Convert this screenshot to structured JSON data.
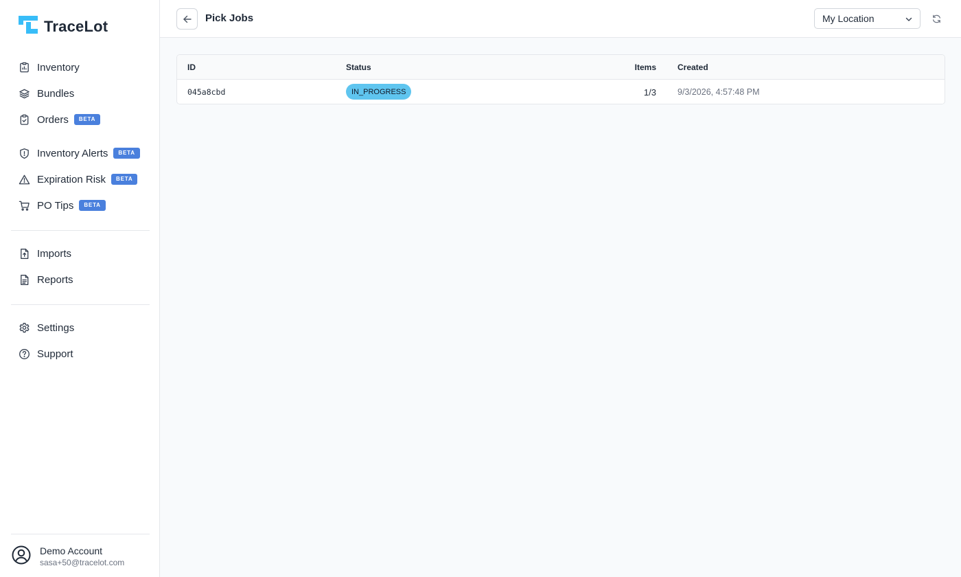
{
  "app": {
    "name": "TraceLot"
  },
  "sidebar": {
    "items": [
      {
        "label": "Inventory",
        "icon": "inventory-icon"
      },
      {
        "label": "Bundles",
        "icon": "layers-icon"
      },
      {
        "label": "Orders",
        "icon": "clipboard-icon",
        "badge": "BETA"
      },
      {
        "label": "Inventory Alerts",
        "icon": "shield-icon",
        "badge": "BETA"
      },
      {
        "label": "Expiration Risk",
        "icon": "warning-icon",
        "badge": "BETA"
      },
      {
        "label": "PO Tips",
        "icon": "cart-icon",
        "badge": "BETA"
      },
      {
        "label": "Imports",
        "icon": "file-upload-icon"
      },
      {
        "label": "Reports",
        "icon": "file-text-icon"
      },
      {
        "label": "Settings",
        "icon": "gear-icon"
      },
      {
        "label": "Support",
        "icon": "help-icon"
      }
    ],
    "account": {
      "name": "Demo Account",
      "email": "sasa+50@tracelot.com"
    }
  },
  "header": {
    "title": "Pick Jobs",
    "location_select": "My Location"
  },
  "table": {
    "columns": {
      "id": "ID",
      "status": "Status",
      "items": "Items",
      "created": "Created"
    },
    "rows": [
      {
        "id": "045a8cbd",
        "status": "IN_PROGRESS",
        "items": "1/3",
        "created": "9/3/2026, 4:57:48 PM"
      }
    ]
  },
  "colors": {
    "brand": "#38bdf8",
    "badge": "#4a80dd",
    "status_in_progress": "#5fc5ef",
    "background": "#f8fafc"
  }
}
